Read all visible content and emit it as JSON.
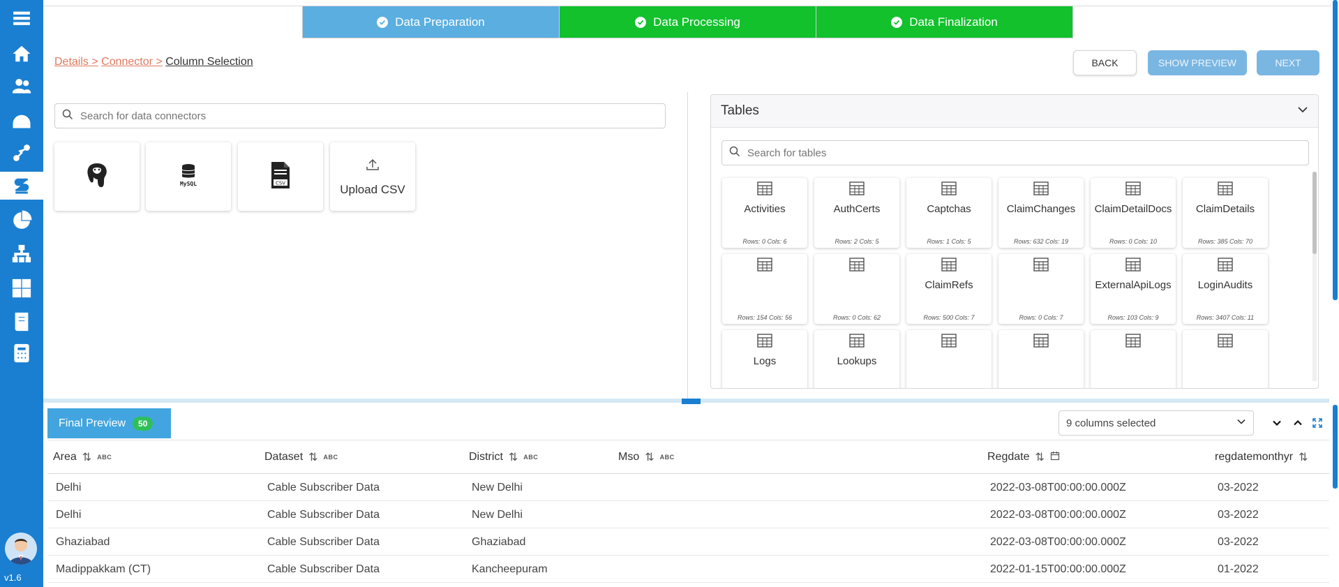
{
  "app": {
    "version": "v1.6"
  },
  "sidebar": {
    "items": [
      {
        "icon": "menu-icon"
      },
      {
        "icon": "home-icon"
      },
      {
        "icon": "users-icon"
      },
      {
        "icon": "dashboard-icon"
      },
      {
        "icon": "workflow-icon"
      },
      {
        "icon": "data-studio-icon",
        "active": true
      },
      {
        "icon": "pie-chart-icon"
      },
      {
        "icon": "hierarchy-icon"
      },
      {
        "icon": "grid-icon"
      },
      {
        "icon": "book-icon"
      },
      {
        "icon": "calculator-icon"
      }
    ]
  },
  "stepper": {
    "steps": [
      {
        "label": "Data Preparation",
        "color": "#5aaee0"
      },
      {
        "label": "Data Processing",
        "color": "#12c12c"
      },
      {
        "label": "Data Finalization",
        "color": "#12c12c"
      }
    ]
  },
  "breadcrumb": {
    "items": [
      "Details >",
      "Connector >"
    ],
    "current": "Column Selection"
  },
  "actions": {
    "back": "BACK",
    "show_preview": "SHOW PREVIEW",
    "next": "NEXT"
  },
  "connectors": {
    "search_placeholder": "Search for data connectors",
    "items": [
      {
        "icon": "postgresql-icon",
        "label": ""
      },
      {
        "icon": "mysql-icon",
        "label": ""
      },
      {
        "icon": "csv-file-icon",
        "label": ""
      },
      {
        "icon": "upload-icon",
        "label": "Upload CSV"
      }
    ]
  },
  "tables": {
    "title": "Tables",
    "search_placeholder": "Search for tables",
    "items": [
      {
        "name": "Activities",
        "meta": "Rows: 0 Cols: 6"
      },
      {
        "name": "AuthCerts",
        "meta": "Rows: 2 Cols: 5"
      },
      {
        "name": "Captchas",
        "meta": "Rows: 1 Cols: 5"
      },
      {
        "name": "ClaimChanges",
        "meta": "Rows: 632 Cols: 19"
      },
      {
        "name": "ClaimDetailDocs",
        "meta": "Rows: 0 Cols: 10"
      },
      {
        "name": "ClaimDetails",
        "meta": "Rows: 385 Cols: 70"
      },
      {
        "name": "",
        "meta": "Rows: 154 Cols: 56"
      },
      {
        "name": "",
        "meta": "Rows: 0 Cols: 62"
      },
      {
        "name": "ClaimRefs",
        "meta": "Rows: 500 Cols: 7"
      },
      {
        "name": "",
        "meta": "Rows: 0 Cols: 7"
      },
      {
        "name": "ExternalApiLogs",
        "meta": "Rows: 103 Cols: 9"
      },
      {
        "name": "LoginAudits",
        "meta": "Rows: 3407 Cols: 11"
      },
      {
        "name": "Logs",
        "meta": ""
      },
      {
        "name": "Lookups",
        "meta": ""
      },
      {
        "name": "",
        "meta": ""
      },
      {
        "name": "",
        "meta": ""
      },
      {
        "name": "",
        "meta": ""
      },
      {
        "name": "",
        "meta": ""
      }
    ]
  },
  "preview": {
    "tab_label": "Final Preview",
    "count": "50",
    "columns_selected": "9 columns selected",
    "columns": [
      {
        "name": "Area",
        "type": "ABC"
      },
      {
        "name": "Dataset",
        "type": "ABC"
      },
      {
        "name": "District",
        "type": "ABC"
      },
      {
        "name": "Mso",
        "type": "ABC"
      },
      {
        "name": "Regdate",
        "type": "date"
      },
      {
        "name": "regdatemonthyr",
        "type": ""
      }
    ],
    "rows": [
      [
        "Delhi",
        "Cable Subscriber Data",
        "New Delhi",
        "",
        "2022-03-08T00:00:00.000Z",
        "03-2022"
      ],
      [
        "Delhi",
        "Cable Subscriber Data",
        "New Delhi",
        "",
        "2022-03-08T00:00:00.000Z",
        "03-2022"
      ],
      [
        "Ghaziabad",
        "Cable Subscriber Data",
        "Ghaziabad",
        "",
        "2022-03-08T00:00:00.000Z",
        "03-2022"
      ],
      [
        "Madippakkam (CT)",
        "Cable Subscriber Data",
        "Kancheepuram",
        "",
        "2022-01-15T00:00:00.000Z",
        "01-2022"
      ]
    ]
  }
}
